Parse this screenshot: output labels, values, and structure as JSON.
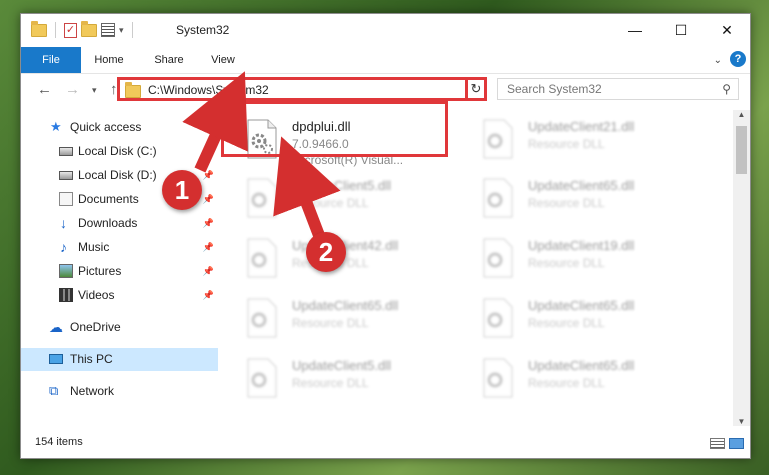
{
  "window": {
    "title": "System32"
  },
  "controls": {
    "minimize": "—",
    "maximize": "☐",
    "close": "✕"
  },
  "ribbon": {
    "tabs": [
      {
        "label": "File"
      },
      {
        "label": "Home"
      },
      {
        "label": "Share"
      },
      {
        "label": "View"
      }
    ],
    "help": "?"
  },
  "address": {
    "path": "C:\\Windows\\System32"
  },
  "search": {
    "placeholder": "Search System32"
  },
  "sidebar": {
    "items": [
      {
        "label": "Quick access",
        "icon": "star-icon"
      },
      {
        "label": "Local Disk (C:)",
        "icon": "disk-icon"
      },
      {
        "label": "Local Disk (D:)",
        "icon": "disk-icon"
      },
      {
        "label": "Documents",
        "icon": "documents-icon"
      },
      {
        "label": "Downloads",
        "icon": "download-icon"
      },
      {
        "label": "Music",
        "icon": "music-icon"
      },
      {
        "label": "Pictures",
        "icon": "pictures-icon"
      },
      {
        "label": "Videos",
        "icon": "videos-icon"
      },
      {
        "label": "OneDrive",
        "icon": "onedrive-icon"
      },
      {
        "label": "This PC",
        "icon": "computer-icon",
        "selected": true
      },
      {
        "label": "Network",
        "icon": "network-icon"
      }
    ]
  },
  "files": [
    {
      "name": "dpdplui.dll",
      "version": "7.0.9466.0",
      "description": "Microsoft(R) Visual..."
    },
    {
      "name": "UpdateClient21.dll",
      "type": "Resource DLL"
    },
    {
      "name": "UpdateClient5.dll",
      "type": "Resource DLL"
    },
    {
      "name": "UpdateClient65.dll",
      "type": "Resource DLL"
    },
    {
      "name": "UpdateClient42.dll",
      "type": "Resource DLL"
    },
    {
      "name": "UpdateClient19.dll",
      "type": "Resource DLL"
    },
    {
      "name": "UpdateClient65.dll",
      "type": "Resource DLL"
    },
    {
      "name": "UpdateClient65.dll",
      "type": "Resource DLL"
    },
    {
      "name": "UpdateClient5.dll",
      "type": "Resource DLL"
    },
    {
      "name": "UpdateClient65.dll",
      "type": "Resource DLL"
    }
  ],
  "status": {
    "count": "154 items"
  },
  "annotations": {
    "step1": "1",
    "step2": "2",
    "color": "#d42f2f"
  }
}
